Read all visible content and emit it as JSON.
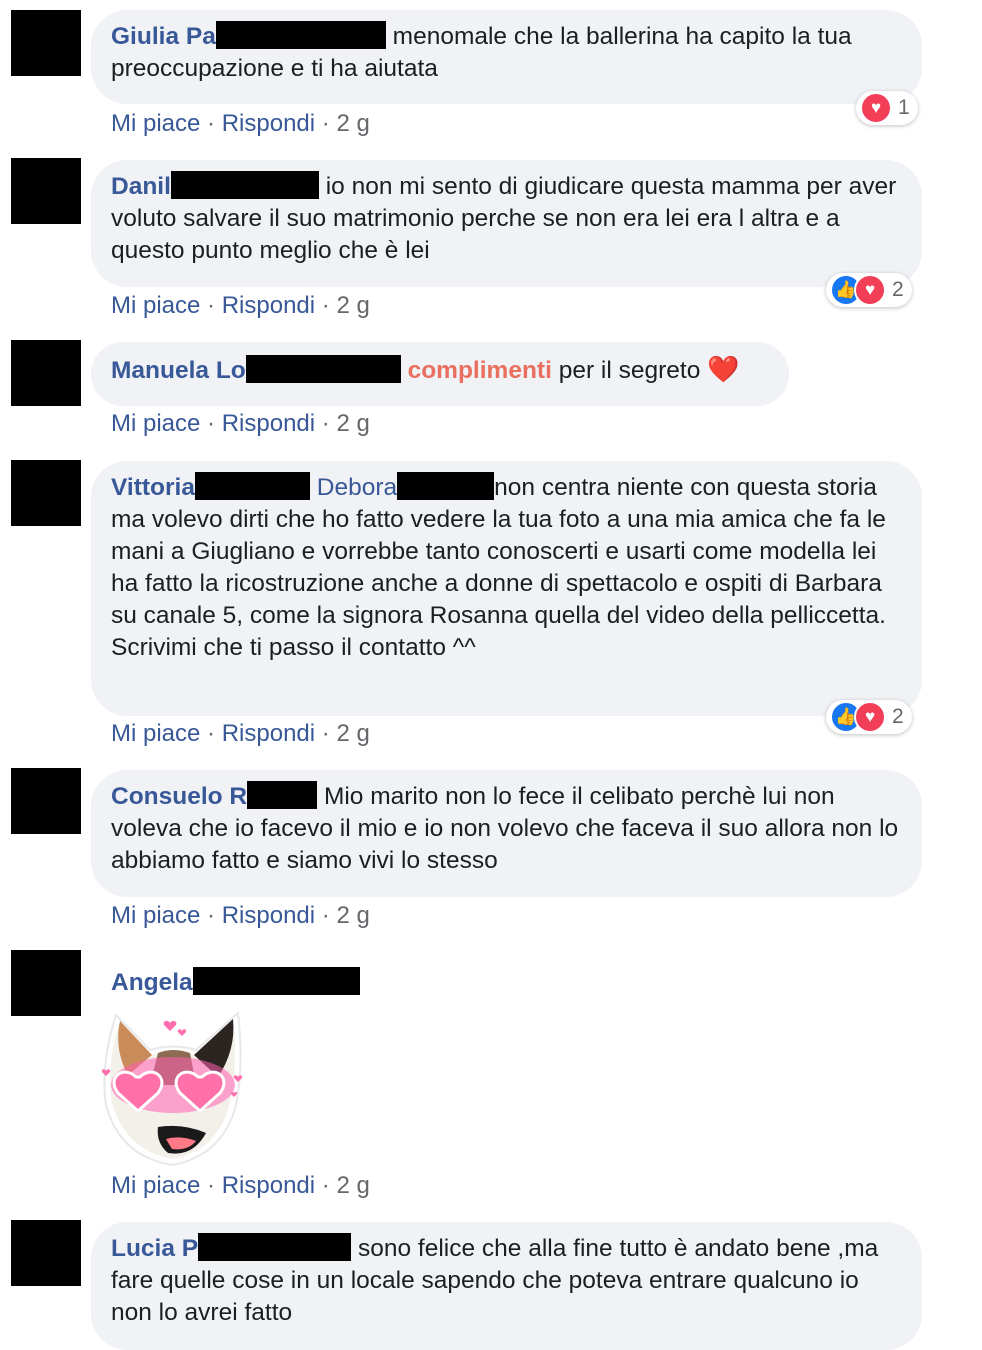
{
  "comments": [
    {
      "name": "Giulia Pa",
      "text": "menomale che la ballerina ha capito la tua preoccupazione e ti ha aiutata",
      "like": "Mi piace",
      "reply": "Rispondi",
      "time": "2 g",
      "reaction_count": "1"
    },
    {
      "name": "Danil",
      "text": "io non mi sento di giudicare questa mamma per aver voluto salvare il suo matrimonio perche se non era lei era l altra e a questo punto meglio che è lei",
      "like": "Mi piace",
      "reply": "Rispondi",
      "time": "2 g",
      "reaction_count": "2"
    },
    {
      "name": "Manuela Lo",
      "highlight": "complimenti",
      "text": "per il segreto",
      "emoji": "❤️",
      "like": "Mi piace",
      "reply": "Rispondi",
      "time": "2 g"
    },
    {
      "name": "Vittoria",
      "mention": "Debora",
      "text": "non centra niente con questa storia ma volevo dirti che ho fatto vedere la tua foto a una mia amica che fa le mani a Giugliano e vorrebbe tanto conoscerti e usarti come modella lei ha fatto la ricostruzione anche a donne di spettacolo e ospiti di Barbara su canale 5, come la signora Rosanna quella del video della pelliccetta. Scrivimi che ti passo il contatto ^^",
      "like": "Mi piace",
      "reply": "Rispondi",
      "time": "2 g",
      "reaction_count": "2"
    },
    {
      "name": "Consuelo R",
      "text": "Mio marito non lo fece il celibato perchè lui non voleva che io facevo il mio e io non volevo che faceva il suo allora non lo abbiamo fatto e siamo vivi lo stesso",
      "like": "Mi piace",
      "reply": "Rispondi",
      "time": "2 g"
    },
    {
      "name": "Angela",
      "sticker": "cat-heart-eyes-sticker",
      "like": "Mi piace",
      "reply": "Rispondi",
      "time": "2 g"
    },
    {
      "name": "Lucia P",
      "text": "sono felice che alla fine tutto è andato bene ,ma fare quelle cose in un locale sapendo che poteva entrare qualcuno io non lo avrei fatto"
    }
  ],
  "separator": "·",
  "colors": {
    "name": "#385898",
    "bubble": "#f0f2f5",
    "meta": "#65676b",
    "highlight": "#e9705f",
    "like": "#1877f2",
    "love": "#f33e58"
  }
}
